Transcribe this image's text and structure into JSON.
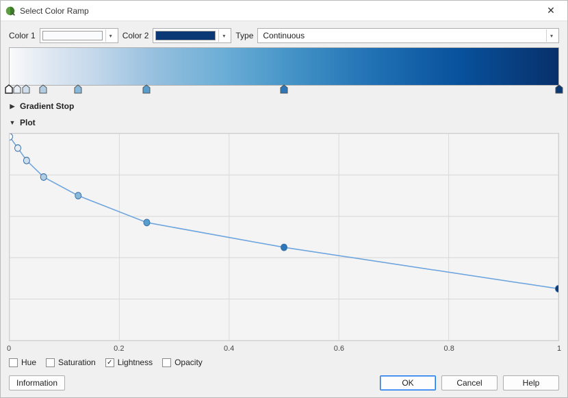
{
  "window": {
    "title": "Select Color Ramp"
  },
  "top": {
    "color1_label": "Color 1",
    "color1": "#fafbfd",
    "color2_label": "Color 2",
    "color2": "#0a3975",
    "type_label": "Type",
    "type_value": "Continuous"
  },
  "gradient": {
    "stops": [
      {
        "pos": 0.0,
        "color": "#fafbfd",
        "selected": true
      },
      {
        "pos": 0.015,
        "color": "#e6edf5",
        "selected": false
      },
      {
        "pos": 0.031,
        "color": "#cfdeed",
        "selected": false
      },
      {
        "pos": 0.062,
        "color": "#b0cde3",
        "selected": false
      },
      {
        "pos": 0.125,
        "color": "#89b9da",
        "selected": false
      },
      {
        "pos": 0.25,
        "color": "#589ecd",
        "selected": false
      },
      {
        "pos": 0.5,
        "color": "#2b77b9",
        "selected": false
      },
      {
        "pos": 1.0,
        "color": "#0a3975",
        "selected": false
      }
    ]
  },
  "sections": {
    "gradient_stop_label": "Gradient Stop",
    "gradient_stop_expanded": false,
    "plot_label": "Plot",
    "plot_expanded": true
  },
  "plot": {
    "ticks": [
      "0",
      "0.2",
      "0.4",
      "0.6",
      "0.8",
      "1"
    ],
    "checks": {
      "hue": {
        "label": "Hue",
        "checked": false
      },
      "saturation": {
        "label": "Saturation",
        "checked": false
      },
      "lightness": {
        "label": "Lightness",
        "checked": true
      },
      "opacity": {
        "label": "Opacity",
        "checked": false
      }
    }
  },
  "chart_data": {
    "type": "line",
    "title": "",
    "xlabel": "",
    "ylabel": "",
    "xlim": [
      0,
      1
    ],
    "ylim": [
      0,
      1
    ],
    "series": [
      {
        "name": "Lightness",
        "x": [
          0.0,
          0.015,
          0.031,
          0.062,
          0.125,
          0.25,
          0.5,
          1.0
        ],
        "y": [
          0.985,
          0.93,
          0.87,
          0.79,
          0.7,
          0.57,
          0.45,
          0.25
        ],
        "colors": [
          "#fafbfd",
          "#e6edf5",
          "#cfdeed",
          "#b0cde3",
          "#89b9da",
          "#589ecd",
          "#2b77b9",
          "#0a3975"
        ]
      }
    ]
  },
  "buttons": {
    "information": "Information",
    "ok": "OK",
    "cancel": "Cancel",
    "help": "Help"
  }
}
